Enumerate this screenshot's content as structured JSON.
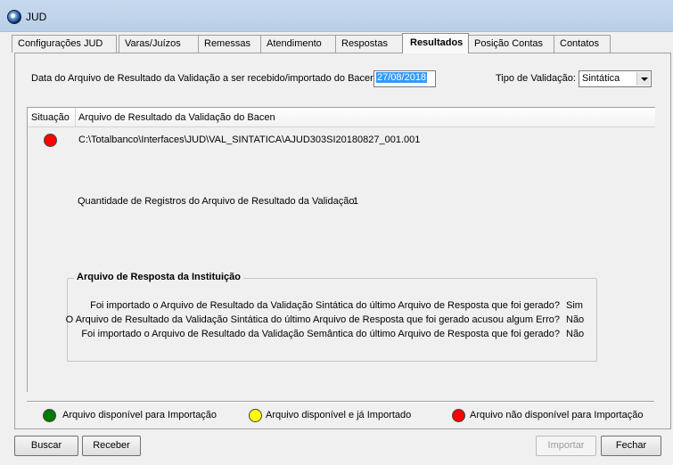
{
  "window": {
    "title": "JUD"
  },
  "tabs": [
    {
      "label": "Configurações JUD"
    },
    {
      "label": "Varas/Juízos"
    },
    {
      "label": "Remessas"
    },
    {
      "label": "Atendimento"
    },
    {
      "label": "Respostas"
    },
    {
      "label": "Resultados"
    },
    {
      "label": "Posição Contas"
    },
    {
      "label": "Contatos"
    }
  ],
  "form": {
    "date_label": "Data do Arquivo de Resultado da Validação a ser recebido/importado do Bacen:",
    "date_value": "27/08/2018",
    "type_label": "Tipo de Validação:",
    "type_value": "Sintática"
  },
  "list": {
    "headers": {
      "situacao": "Situação",
      "arquivo": "Arquivo de Resultado da Validação do Bacen"
    },
    "rows": [
      {
        "status": "red",
        "file": "C:\\Totalbanco\\Interfaces\\JUD\\VAL_SINTATICA\\AJUD303SI20180827_001.001"
      }
    ],
    "count_label": "Quantidade de Registros do Arquivo de Resultado da Validação:",
    "count_value": "1"
  },
  "response": {
    "title": "Arquivo de Resposta da Instituição",
    "q1": "Foi importado o Arquivo de Resultado da Validação Sintática do último Arquivo de Resposta que foi gerado?",
    "a1": "Sim",
    "q2": "O Arquivo de Resultado da Validação Sintática do último Arquivo de Resposta que foi gerado acusou algum Erro?",
    "a2": "Não",
    "q3": "Foi importado o Arquivo de Resultado da Validação Semântica do último Arquivo de Resposta que foi gerado?",
    "a3": "Não"
  },
  "legend": {
    "green": "Arquivo disponível para Importação",
    "yellow": "Arquivo disponível e já Importado",
    "red": "Arquivo não disponível para Importação"
  },
  "buttons": {
    "buscar": "Buscar",
    "receber": "Receber",
    "importar": "Importar",
    "fechar": "Fechar"
  },
  "colors": {
    "green": "#007a00",
    "yellow": "#ffff00",
    "red": "#ff0000",
    "selection": "#3399ff"
  }
}
